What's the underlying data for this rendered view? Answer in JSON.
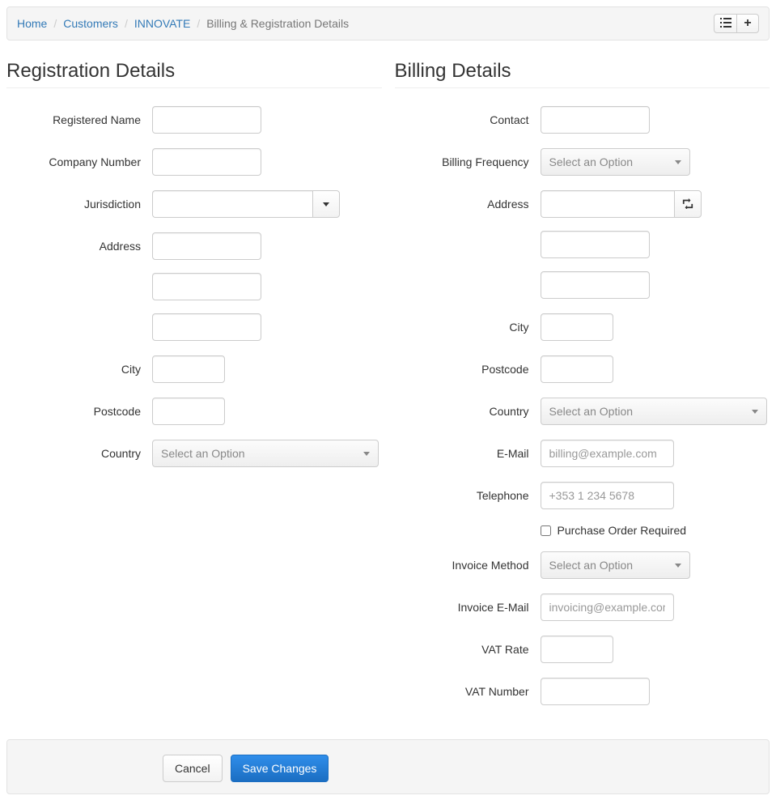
{
  "breadcrumb": {
    "home": "Home",
    "customers": "Customers",
    "customer": "INNOVATE",
    "current": "Billing & Registration Details"
  },
  "sections": {
    "reg_title": "Registration Details",
    "bill_title": "Billing Details"
  },
  "reg": {
    "registered_name_label": "Registered Name",
    "company_number_label": "Company Number",
    "jurisdiction_label": "Jurisdiction",
    "address_label": "Address",
    "city_label": "City",
    "postcode_label": "Postcode",
    "country_label": "Country",
    "country_placeholder": "Select an Option"
  },
  "bill": {
    "contact_label": "Contact",
    "frequency_label": "Billing Frequency",
    "frequency_placeholder": "Select an Option",
    "address_label": "Address",
    "city_label": "City",
    "postcode_label": "Postcode",
    "country_label": "Country",
    "country_placeholder": "Select an Option",
    "email_label": "E-Mail",
    "email_placeholder": "billing@example.com",
    "telephone_label": "Telephone",
    "telephone_placeholder": "+353 1 234 5678",
    "po_required_label": "Purchase Order Required",
    "invoice_method_label": "Invoice Method",
    "invoice_method_placeholder": "Select an Option",
    "invoice_email_label": "Invoice E-Mail",
    "invoice_email_placeholder": "invoicing@example.com",
    "vat_rate_label": "VAT Rate",
    "vat_number_label": "VAT Number"
  },
  "footer": {
    "cancel": "Cancel",
    "save": "Save Changes"
  }
}
